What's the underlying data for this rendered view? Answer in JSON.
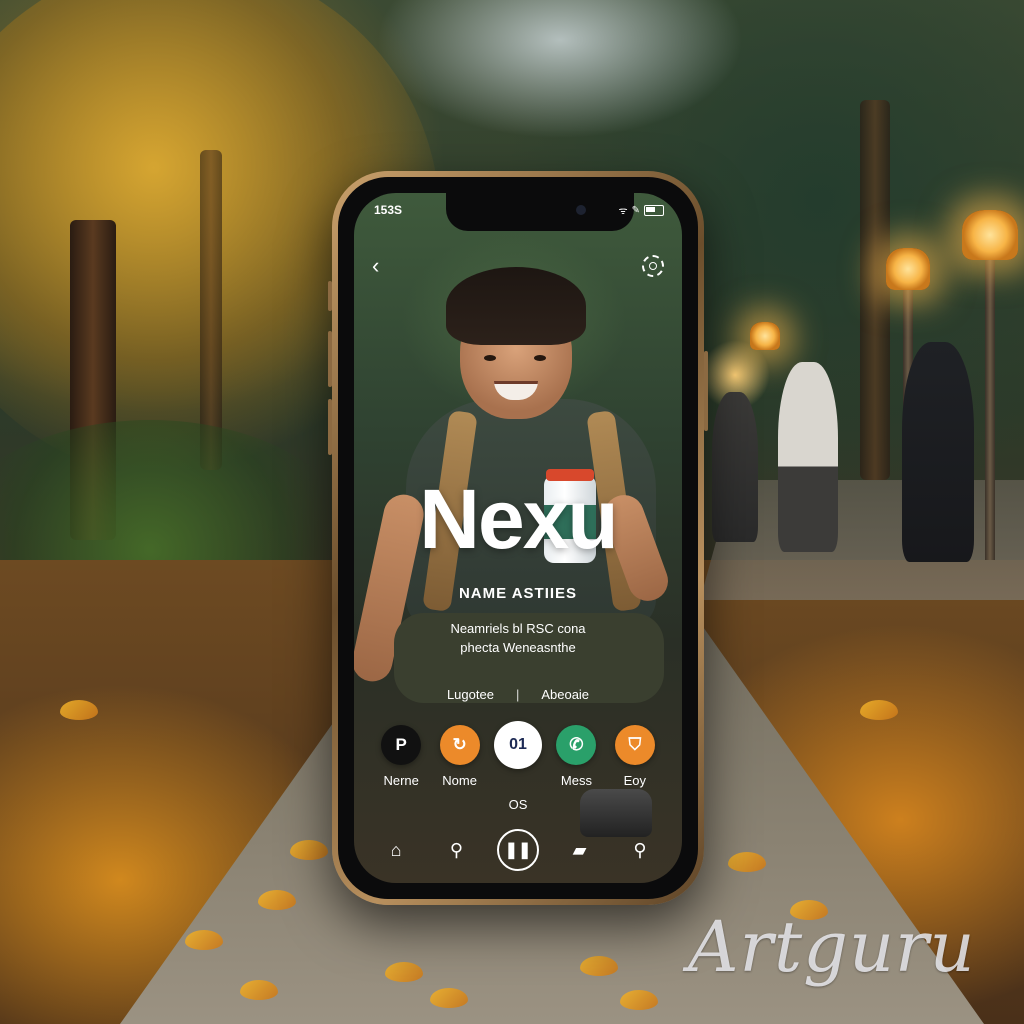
{
  "watermark": "Artguru",
  "status_bar": {
    "time": "153S",
    "signal": "ᯤ",
    "wifi": "✎"
  },
  "header": {
    "back_icon": "chevron-left-icon",
    "settings_icon": "gear-icon"
  },
  "hero": {
    "brand": "Nexu",
    "subtitle": "NAME ASTIIES",
    "description_line1": "Neamriels bl RSC cona",
    "description_line2": "phecta Weneasnthe"
  },
  "links": {
    "left": "Lugotee",
    "separator": "|",
    "right": "Abeoaie"
  },
  "actions": [
    {
      "label": "Nerne",
      "glyph": "P",
      "color": "#111111",
      "icon": "pin-icon"
    },
    {
      "label": "Nome",
      "glyph": "↻",
      "color": "#ec8a2a",
      "icon": "refresh-icon"
    },
    {
      "label": "",
      "glyph": "01",
      "color": "#ffffff",
      "text_color": "#1d2a54",
      "icon": "center-badge"
    },
    {
      "label": "Mess",
      "glyph": "✆",
      "color": "#2aa06a",
      "icon": "phone-icon"
    },
    {
      "label": "Eoy",
      "glyph": "⛉",
      "color": "#ec8a2a",
      "icon": "user-icon"
    }
  ],
  "os_label": "OS",
  "tabbar": [
    {
      "name": "home",
      "glyph": "⌂",
      "icon": "home-icon"
    },
    {
      "name": "search",
      "glyph": "⚲",
      "icon": "search-icon"
    },
    {
      "name": "play",
      "glyph": "❚❚",
      "icon": "pause-icon"
    },
    {
      "name": "map",
      "glyph": "▰",
      "icon": "map-icon"
    },
    {
      "name": "location",
      "glyph": "⚲",
      "icon": "location-icon"
    }
  ],
  "colors": {
    "accent_orange": "#ec8a2a",
    "accent_green": "#2aa06a",
    "phone_frame": "#b8905e"
  }
}
